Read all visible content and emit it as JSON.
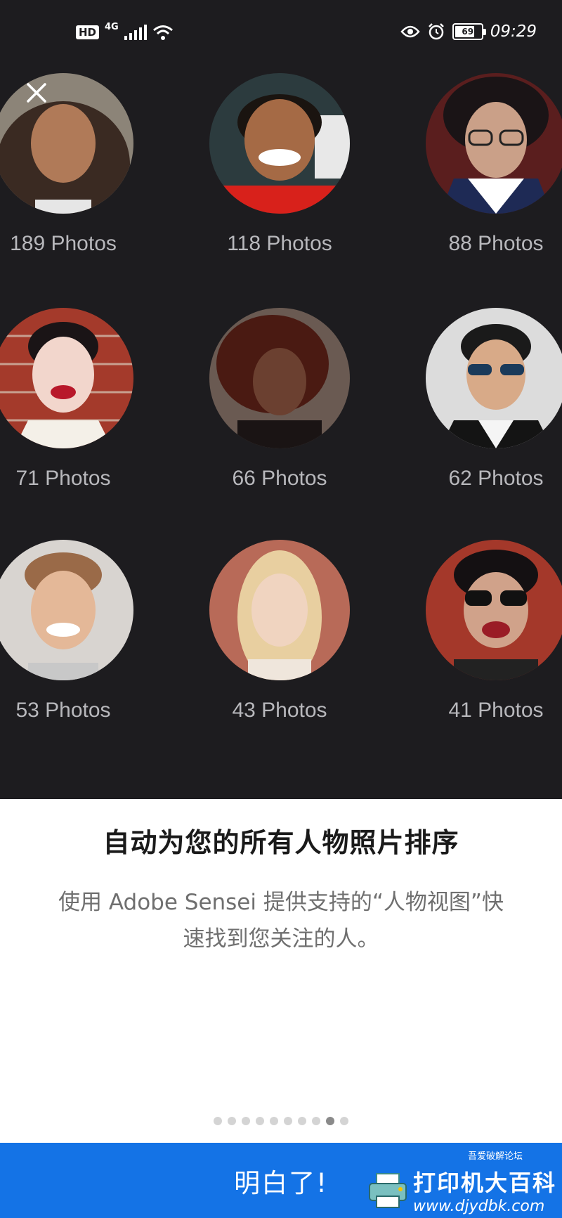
{
  "status_bar": {
    "hd": "HD",
    "network": "4G",
    "battery": "69",
    "time": "09:29"
  },
  "people": [
    {
      "count": "189 Photos"
    },
    {
      "count": "118 Photos"
    },
    {
      "count": "88 Photos"
    },
    {
      "count": "71 Photos"
    },
    {
      "count": "66 Photos"
    },
    {
      "count": "62 Photos"
    },
    {
      "count": "53 Photos"
    },
    {
      "count": "43 Photos"
    },
    {
      "count": "41 Photos"
    }
  ],
  "headline": "自动为您的所有人物照片排序",
  "description": "使用 Adobe Sensei 提供支持的“人物视图”快速找到您关注的人。",
  "pager": {
    "total": 10,
    "active": 9
  },
  "cta": {
    "label": "明白了!"
  },
  "watermark": {
    "site_cn": "打印机大百科",
    "url": "www.djydbk.com",
    "small": "吾爱破解论坛"
  },
  "colors": {
    "accent": "#1473e6",
    "dark_bg": "#1d1c1f"
  }
}
